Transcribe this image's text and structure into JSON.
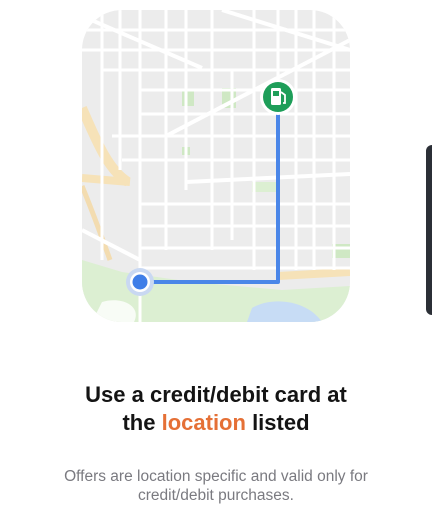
{
  "onboarding": {
    "headline_part1": "Use a credit/debit card at",
    "headline_part2": "the",
    "headline_highlight": "location",
    "headline_part3": "listed",
    "body_text": "Offers are location specific and valid only for credit/debit purchases.",
    "accent_color": "#e57036"
  },
  "map": {
    "destination_icon": "gas-station-icon",
    "origin_icon": "current-location-dot-icon",
    "route_color": "#4a86e8",
    "marker_color": "#1e9e59"
  }
}
